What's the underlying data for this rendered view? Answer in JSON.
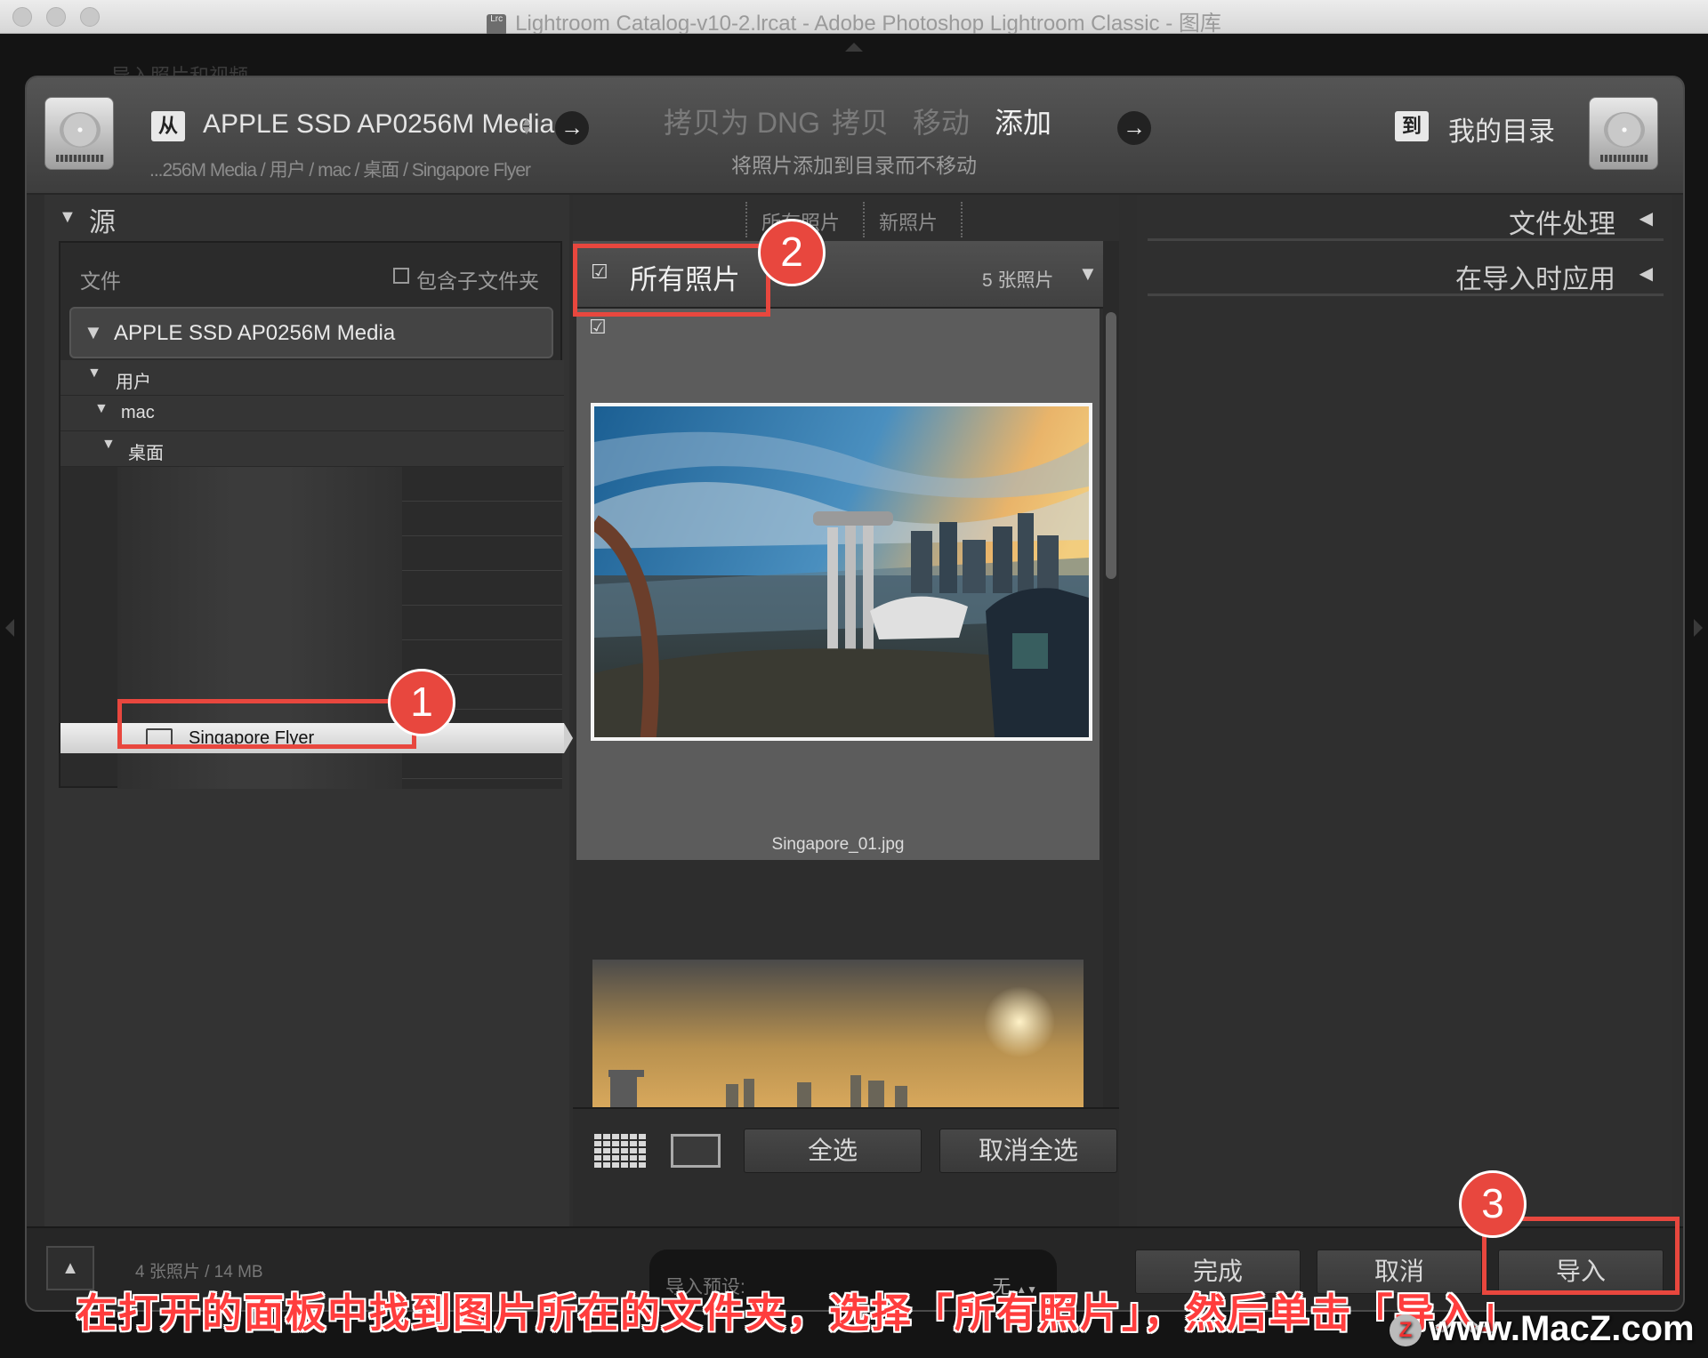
{
  "window": {
    "title": "Lightroom Catalog-v10-2.lrcat - Adobe Photoshop Lightroom Classic - 图库",
    "app_badge": "Lrc"
  },
  "background": {
    "hint": "导入照片和视频"
  },
  "header": {
    "from_badge": "从",
    "source_name": "APPLE SSD AP0256M Media",
    "source_path": "...256M Media / 用户 / mac / 桌面 / Singapore Flyer",
    "modes": [
      "拷贝为 DNG",
      "拷贝",
      "移动",
      "添加"
    ],
    "active_mode": "添加",
    "mode_description": "将照片添加到目录而不移动",
    "to_badge": "到",
    "destination_name": "我的目录"
  },
  "source_panel": {
    "title": "源",
    "files_label": "文件",
    "include_subfolders": "包含子文件夹",
    "volume": "APPLE SSD AP0256M Media",
    "tree": [
      "用户",
      "mac",
      "桌面"
    ],
    "selected_folder": "Singapore Flyer"
  },
  "center": {
    "tabs": [
      "所有照片",
      "新照片"
    ],
    "all_photos_label": "所有照片",
    "photo_count": "5 张照片",
    "photos": [
      {
        "filename": "Singapore_01.jpg",
        "checked": true
      }
    ],
    "select_all": "全选",
    "deselect_all": "取消全选"
  },
  "right_panel": {
    "sections": [
      "文件处理",
      "在导入时应用"
    ]
  },
  "footer": {
    "size_summary": "4 张照片 / 14 MB",
    "preset_label": "导入预设:",
    "preset_value": "无",
    "done": "完成",
    "cancel": "取消",
    "import": "导入"
  },
  "annotations": {
    "step1": "1",
    "step2": "2",
    "step3": "3",
    "caption": "在打开的面板中找到图片所在的文件夹，选择「所有照片」，然后单击「导入」",
    "watermark": "www.MacZ.com",
    "watermark_logo": "Z",
    "highlight_color": "#e8473e"
  },
  "icons": {
    "arrow": "→",
    "triangle_down": "▼",
    "triangle_left": "◀",
    "triangle_up": "▲",
    "check": "☑",
    "updown": "▲▼"
  }
}
